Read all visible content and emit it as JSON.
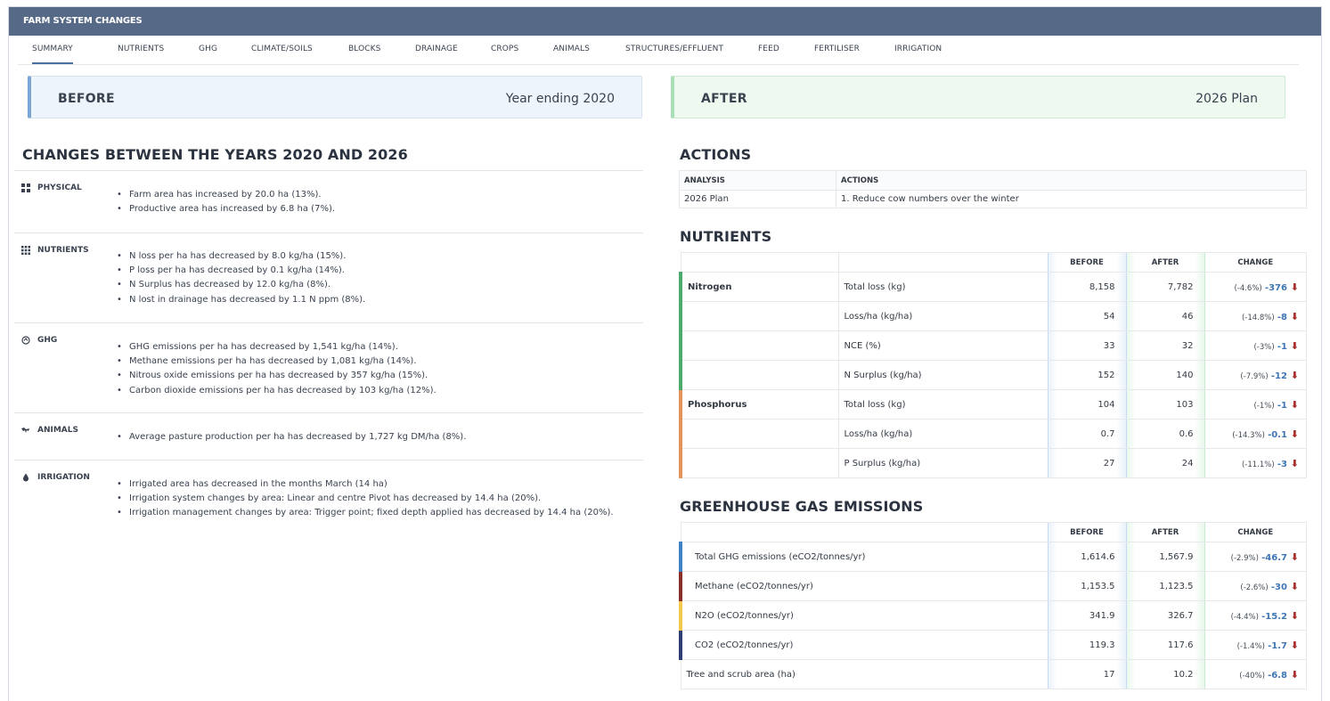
{
  "app": {
    "title": "FARM SYSTEM CHANGES"
  },
  "tabs": [
    "SUMMARY",
    "NUTRIENTS",
    "GHG",
    "CLIMATE/SOILS",
    "BLOCKS",
    "DRAINAGE",
    "CROPS",
    "ANIMALS",
    "STRUCTURES/EFFLUENT",
    "FEED",
    "FERTILISER",
    "IRRIGATION"
  ],
  "active_tab": "SUMMARY",
  "before": {
    "label": "BEFORE",
    "value": "Year ending 2020"
  },
  "after": {
    "label": "AFTER",
    "value": "2026 Plan"
  },
  "changes": {
    "title": "CHANGES BETWEEN THE YEARS 2020 AND 2026",
    "sections": [
      {
        "label": "PHYSICAL",
        "icon": "blocks-icon",
        "items": [
          "Farm area has increased by 20.0 ha (13%).",
          "Productive area has increased by 6.8 ha (7%)."
        ]
      },
      {
        "label": "NUTRIENTS",
        "icon": "grid-icon",
        "items": [
          "N loss per ha has decreased by 8.0 kg/ha (15%).",
          "P loss per ha has decreased by 0.1 kg/ha (14%).",
          "N Surplus has decreased by 12.0 kg/ha (8%).",
          "N lost in drainage has decreased by 1.1 N ppm (8%)."
        ]
      },
      {
        "label": "GHG",
        "icon": "cloud-icon",
        "items": [
          "GHG emissions per ha has decreased by 1,541 kg/ha (14%).",
          "Methane emissions per ha has decreased by 1,081 kg/ha (14%).",
          "Nitrous oxide emissions per ha has decreased by 357 kg/ha (15%).",
          "Carbon dioxide emissions per ha has decreased by 103 kg/ha (12%)."
        ]
      },
      {
        "label": "ANIMALS",
        "icon": "cow-icon",
        "items": [
          "Average pasture production per ha has decreased by 1,727 kg DM/ha (8%)."
        ]
      },
      {
        "label": "IRRIGATION",
        "icon": "water-drop-icon",
        "items": [
          "Irrigated area has decreased in the months March (14 ha)",
          "Irrigation system changes by area: Linear and centre Pivot has decreased by 14.4 ha (20%).",
          "Irrigation management changes by area: Trigger point; fixed depth applied has decreased by 14.4 ha (20%)."
        ]
      }
    ]
  },
  "actions": {
    "title": "ACTIONS",
    "headers": [
      "ANALYSIS",
      "ACTIONS"
    ],
    "rows": [
      {
        "analysis": "2026 Plan",
        "action": "1. Reduce cow numbers over the winter"
      }
    ]
  },
  "nutrients": {
    "title": "NUTRIENTS",
    "headers": {
      "before": "BEFORE",
      "after": "AFTER",
      "change": "CHANGE"
    },
    "rows": [
      {
        "group": "Nitrogen",
        "metric": "Total loss (kg)",
        "before": "8,158",
        "after": "7,782",
        "pct": "(-4.6%)",
        "delta": "-376"
      },
      {
        "group": "",
        "metric": "Loss/ha (kg/ha)",
        "before": "54",
        "after": "46",
        "pct": "(-14.8%)",
        "delta": "-8"
      },
      {
        "group": "",
        "metric": "NCE (%)",
        "before": "33",
        "after": "32",
        "pct": "(-3%)",
        "delta": "-1"
      },
      {
        "group": "",
        "metric": "N Surplus (kg/ha)",
        "before": "152",
        "after": "140",
        "pct": "(-7.9%)",
        "delta": "-12"
      },
      {
        "group": "Phosphorus",
        "metric": "Total loss (kg)",
        "before": "104",
        "after": "103",
        "pct": "(-1%)",
        "delta": "-1"
      },
      {
        "group": "",
        "metric": "Loss/ha (kg/ha)",
        "before": "0.7",
        "after": "0.6",
        "pct": "(-14.3%)",
        "delta": "-0.1"
      },
      {
        "group": "",
        "metric": "P Surplus (kg/ha)",
        "before": "27",
        "after": "24",
        "pct": "(-11.1%)",
        "delta": "-3"
      }
    ]
  },
  "ghg": {
    "title": "GREENHOUSE GAS EMISSIONS",
    "headers": {
      "before": "BEFORE",
      "after": "AFTER",
      "change": "CHANGE"
    },
    "rows": [
      {
        "metric": "Total GHG emissions (eCO2/tonnes/yr)",
        "before": "1,614.6",
        "after": "1,567.9",
        "pct": "(-2.9%)",
        "delta": "-46.7",
        "color": "#3f82c8"
      },
      {
        "metric": "Methane (eCO2/tonnes/yr)",
        "before": "1,153.5",
        "after": "1,123.5",
        "pct": "(-2.6%)",
        "delta": "-30",
        "color": "#8b2f2b"
      },
      {
        "metric": "N2O (eCO2/tonnes/yr)",
        "before": "341.9",
        "after": "326.7",
        "pct": "(-4.4%)",
        "delta": "-15.2",
        "color": "#f2c94c"
      },
      {
        "metric": "CO2 (eCO2/tonnes/yr)",
        "before": "119.3",
        "after": "117.6",
        "pct": "(-1.4%)",
        "delta": "-1.7",
        "color": "#2e3f78"
      },
      {
        "metric": "Tree and scrub area (ha)",
        "before": "17",
        "after": "10.2",
        "pct": "(-40%)",
        "delta": "-6.8",
        "color": ""
      }
    ]
  }
}
